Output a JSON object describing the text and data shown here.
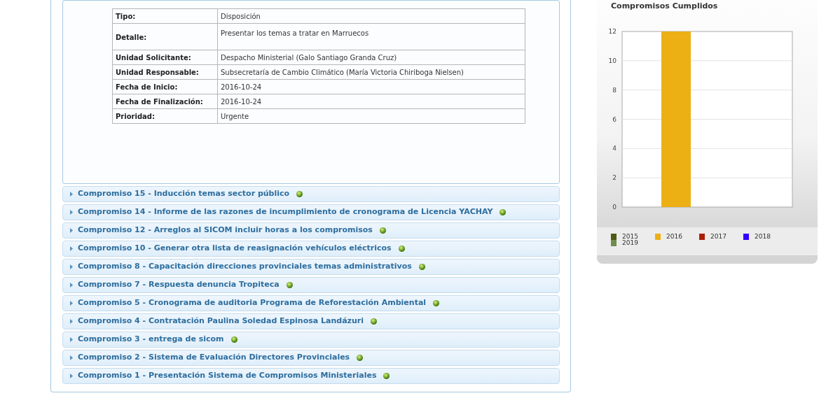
{
  "detail_table": {
    "rows": [
      {
        "label": "Tipo:",
        "value": "Disposición"
      },
      {
        "label": "Detalle:",
        "value": "Presentar los temas a tratar en Marruecos",
        "kind": "tall"
      },
      {
        "label": "Unidad Solicitante:",
        "value": "Despacho Ministerial (Galo Santiago Granda Cruz)"
      },
      {
        "label": "Unidad Responsable:",
        "value": "Subsecretaría de Cambio Climático (María Victoria Chiriboga Nielsen)"
      },
      {
        "label": "Fecha de Inicio:",
        "value": "2016-10-24"
      },
      {
        "label": "Fecha de Finalización:",
        "value": "2016-10-24"
      },
      {
        "label": "Prioridad:",
        "value": "Urgente"
      }
    ]
  },
  "commitments": [
    {
      "title": "Compromiso 15 - Inducción temas sector público",
      "expanded": false
    },
    {
      "title": "Compromiso 14 - Informe de las razones de incumplimiento de cronograma de Licencia YACHAY",
      "expanded": false
    },
    {
      "title": "Compromiso 12 - Arreglos al SICOM incluir horas a los compromisos",
      "expanded": false
    },
    {
      "title": "Compromiso 10 - Generar otra lista de reasignación vehículos eléctricos",
      "expanded": false
    },
    {
      "title": "Compromiso 8 - Capacitación direcciones provinciales temas administrativos",
      "expanded": false
    },
    {
      "title": "Compromiso 7 - Respuesta denuncia Tropiteca",
      "expanded": false
    },
    {
      "title": "Compromiso 5 - Cronograma de auditoria Programa de Reforestación Ambiental",
      "expanded": false
    },
    {
      "title": "Compromiso 4 - Contratación Paulina Soledad Espinosa Landázuri",
      "expanded": false
    },
    {
      "title": "Compromiso 3 - entrega de sicom",
      "expanded": false
    },
    {
      "title": "Compromiso 2 - Sistema de Evaluación Directores Provinciales",
      "expanded": false
    },
    {
      "title": "Compromiso 1 - Presentación Sistema de Compromisos Ministeriales",
      "expanded": false
    }
  ],
  "chart_panel": {
    "chart_data": {
      "type": "bar",
      "title": "Compromisos Cumplidos",
      "categories": [
        null
      ],
      "grid": true,
      "ylim": [
        0,
        12
      ],
      "yticks": [
        0,
        2,
        4,
        6,
        8,
        10,
        12
      ],
      "series": [
        {
          "name": "2015",
          "color": "#4f5b12",
          "values": [
            0
          ]
        },
        {
          "name": "2016",
          "color": "#ecb015",
          "values": [
            12
          ]
        },
        {
          "name": "2017",
          "color": "#aa1f0a",
          "values": [
            0
          ]
        },
        {
          "name": "2018",
          "color": "#3300ff",
          "values": [
            0
          ]
        },
        {
          "name": "2019",
          "color": "#6f8d4e",
          "values": [
            0
          ]
        }
      ]
    }
  }
}
